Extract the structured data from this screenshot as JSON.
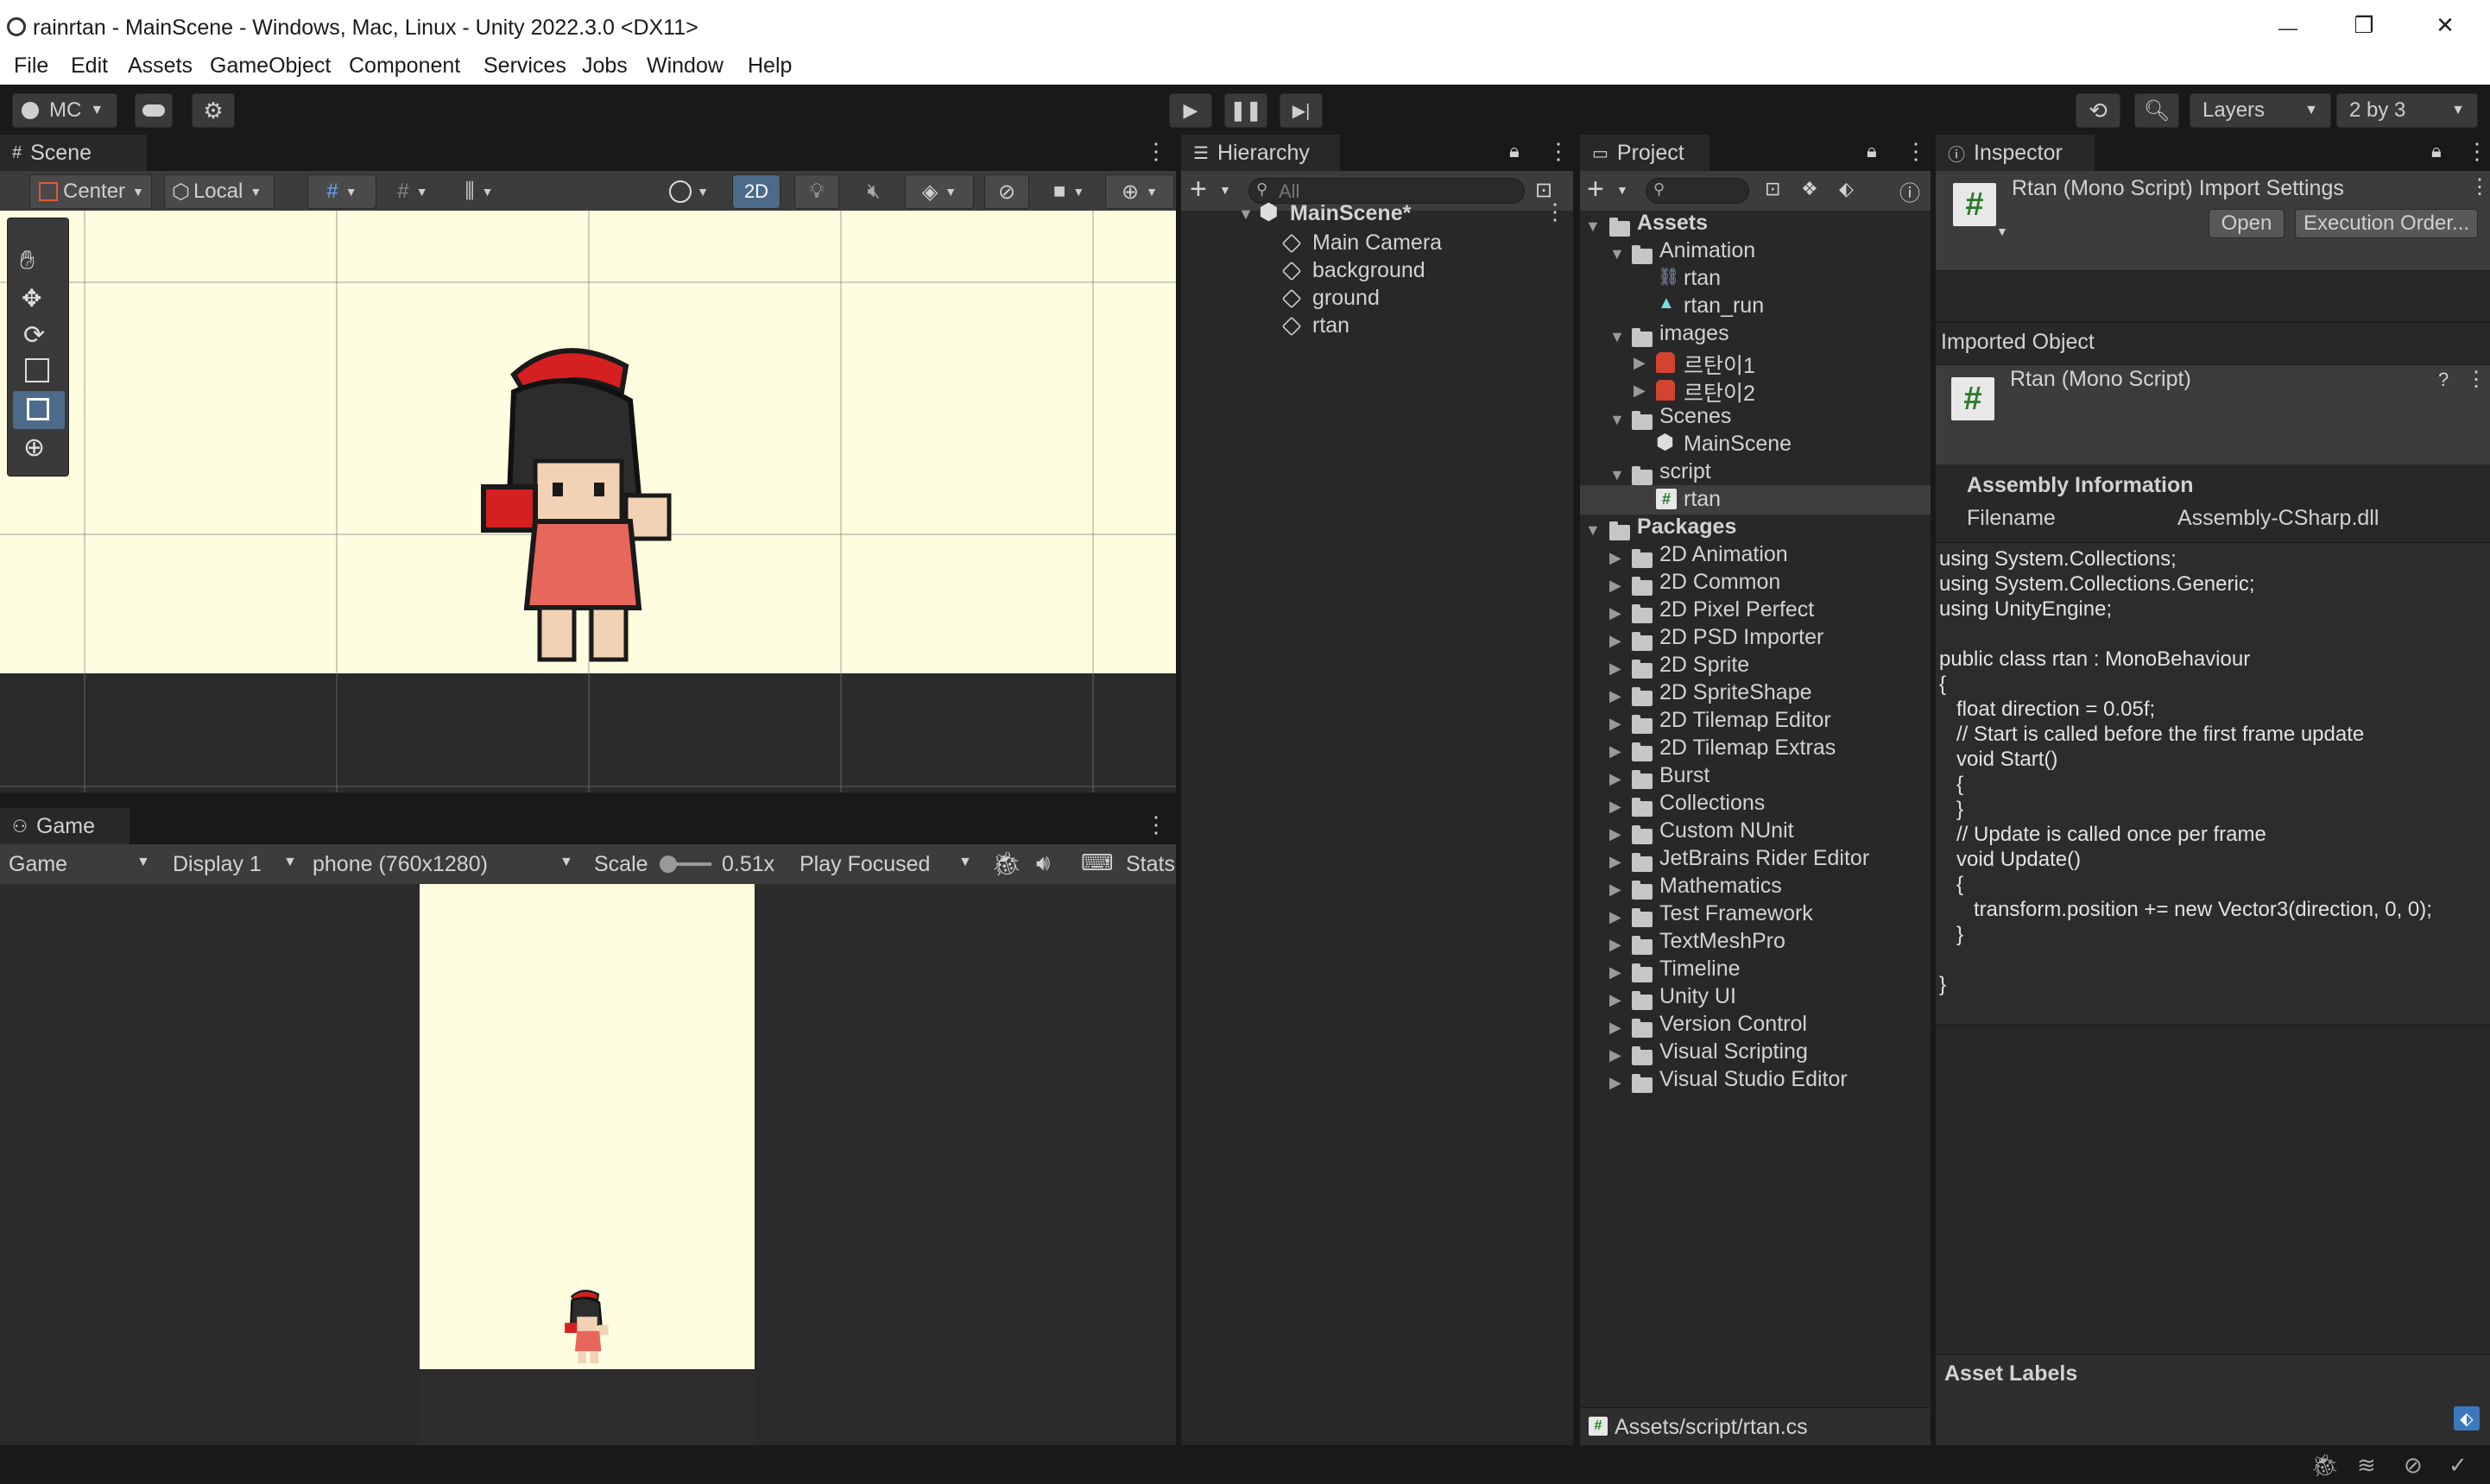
{
  "window": {
    "title": "rainrtan - MainScene - Windows, Mac, Linux - Unity 2022.3.0 <DX11>",
    "minimize": "—",
    "maximize": "❐",
    "close": "✕"
  },
  "menu": [
    "File",
    "Edit",
    "Assets",
    "GameObject",
    "Component",
    "Services",
    "Jobs",
    "Window",
    "Help"
  ],
  "toolbar": {
    "account": "MC",
    "layers": "Layers",
    "layout": "2 by 3"
  },
  "scene": {
    "tab": "Scene",
    "pivot": "Center",
    "space": "Local",
    "mode2d": "2D"
  },
  "game": {
    "tab": "Game",
    "view": "Game",
    "display": "Display 1",
    "resolution": "phone (760x1280)",
    "scale_label": "Scale",
    "scale_value": "0.51x",
    "play_mode": "Play Focused",
    "stats": "Stats"
  },
  "hierarchy": {
    "tab": "Hierarchy",
    "search_placeholder": "All",
    "scene": "MainScene*",
    "items": [
      "Main Camera",
      "background",
      "ground",
      "rtan"
    ]
  },
  "project": {
    "tab": "Project",
    "assets": "Assets",
    "animation": "Animation",
    "anim_items": [
      "rtan",
      "rtan_run"
    ],
    "images": "images",
    "image_items": [
      "르탄이1",
      "르탄이2"
    ],
    "scenes": "Scenes",
    "scene_items": [
      "MainScene"
    ],
    "script": "script",
    "script_items": [
      "rtan"
    ],
    "packages": "Packages",
    "package_items": [
      "2D Animation",
      "2D Common",
      "2D Pixel Perfect",
      "2D PSD Importer",
      "2D Sprite",
      "2D SpriteShape",
      "2D Tilemap Editor",
      "2D Tilemap Extras",
      "Burst",
      "Collections",
      "Custom NUnit",
      "JetBrains Rider Editor",
      "Mathematics",
      "Test Framework",
      "TextMeshPro",
      "Timeline",
      "Unity UI",
      "Version Control",
      "Visual Scripting",
      "Visual Studio Editor"
    ],
    "footer_path": "Assets/script/rtan.cs"
  },
  "inspector": {
    "tab": "Inspector",
    "title": "Rtan (Mono Script) Import Settings",
    "open": "Open",
    "execution_order": "Execution Order...",
    "imported_object": "Imported Object",
    "object_name": "Rtan (Mono Script)",
    "assembly_info": "Assembly Information",
    "filename_label": "Filename",
    "filename_value": "Assembly-CSharp.dll",
    "code": "using System.Collections;\nusing System.Collections.Generic;\nusing UnityEngine;\n\npublic class rtan : MonoBehaviour\n{\n   float direction = 0.05f;\n   // Start is called before the first frame update\n   void Start()\n   {\n   }\n   // Update is called once per frame\n   void Update()\n   {\n      transform.position += new Vector3(direction, 0, 0);\n   }\n\n}",
    "asset_labels": "Asset Labels"
  },
  "colors": {
    "scene_bg": "#fefde0",
    "accent_blue": "#3a79bb",
    "selected": "#3e3e3e"
  }
}
